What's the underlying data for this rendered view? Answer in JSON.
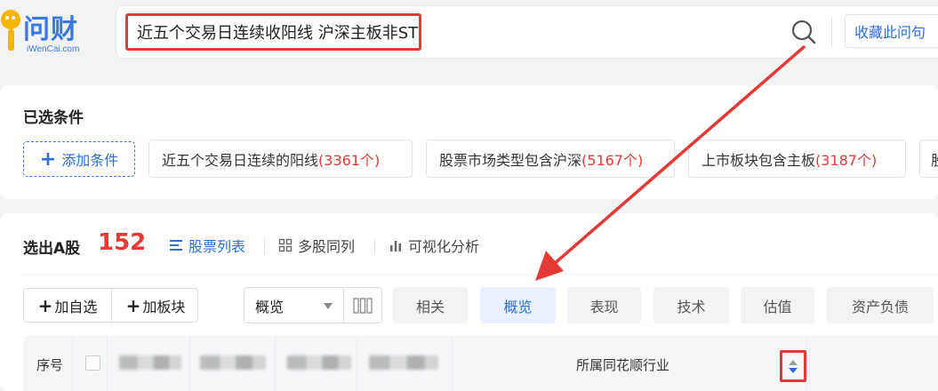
{
  "header": {
    "logo_text": "问财",
    "logo_sub": "iWenCai.com",
    "query": "近五个交易日连续收阳线 沪深主板非ST",
    "favorite_label": "收藏此问句"
  },
  "conditions": {
    "title": "已选条件",
    "add_label": "添加条件",
    "chips": [
      {
        "text": "近五个交易日连续的阳线",
        "count": "(3361个)"
      },
      {
        "text": "股票市场类型包含沪深",
        "count": "(5167个)"
      },
      {
        "text": "上市板块包含主板",
        "count": "(3187个)"
      },
      {
        "text": "股",
        "count": ""
      }
    ]
  },
  "results": {
    "title": "选出A股",
    "count": "152",
    "view_tabs": [
      "股票列表",
      "多股同列",
      "可视化分析"
    ],
    "add_watch_label": "加自选",
    "add_block_label": "加板块",
    "select_value": "概览",
    "category_tabs": [
      "相关",
      "概览",
      "表现",
      "技术",
      "估值",
      "资产负债"
    ],
    "active_category": "概览",
    "table_header": {
      "index": "序号",
      "industry": "所属同花顺行业"
    }
  },
  "colors": {
    "accent": "#2a6fdb",
    "highlight_red": "#e53935"
  }
}
